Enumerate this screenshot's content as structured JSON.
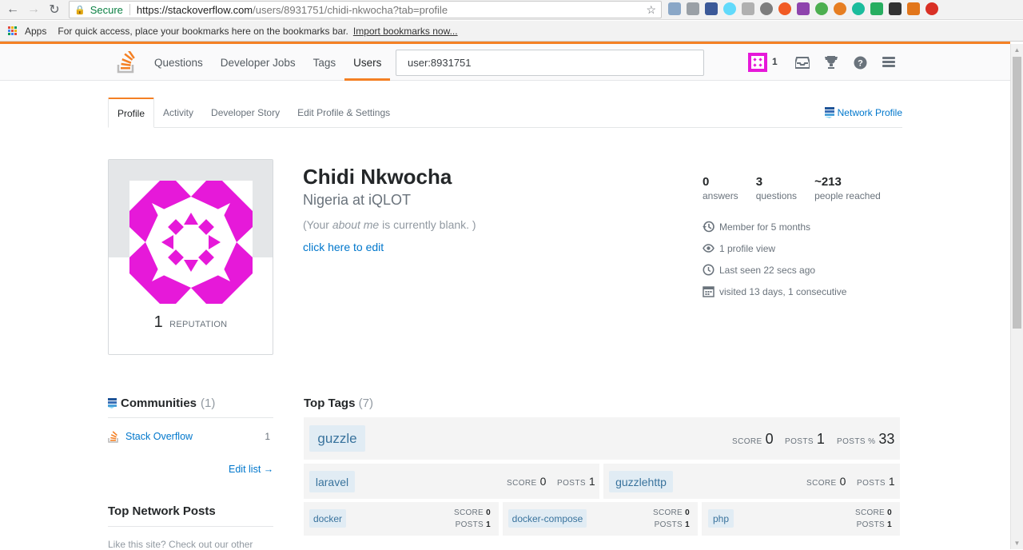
{
  "browser": {
    "secure_label": "Secure",
    "url_host": "https://stackoverflow.com",
    "url_rest": "/users/8931751/chidi-nkwocha?tab=profile",
    "bookmarks_apps": "Apps",
    "bookmarks_hint": "For quick access, place your bookmarks here on the bookmarks bar.",
    "bookmarks_import": "Import bookmarks now..."
  },
  "topbar": {
    "nav": [
      "Questions",
      "Developer Jobs",
      "Tags",
      "Users"
    ],
    "active": "Users",
    "search_value": "user:8931751",
    "rep": "1"
  },
  "tabs": {
    "items": [
      "Profile",
      "Activity",
      "Developer Story",
      "Edit Profile & Settings"
    ],
    "network_profile": "Network Profile"
  },
  "profile": {
    "reputation": "1",
    "reputation_label": "REPUTATION",
    "name": "Chidi Nkwocha",
    "location": "Nigeria at iQLOT",
    "about_prefix": "(Your ",
    "about_em": "about me",
    "about_suffix": " is currently blank. )",
    "edit_link": "click here to edit"
  },
  "stats": {
    "answers": {
      "num": "0",
      "label": "answers"
    },
    "questions": {
      "num": "3",
      "label": "questions"
    },
    "reached": {
      "num": "~213",
      "label": "people reached"
    }
  },
  "meta": {
    "member": "Member for 5 months",
    "views": "1 profile view",
    "last_seen": "Last seen 22 secs ago",
    "visited": "visited 13 days, 1 consecutive"
  },
  "communities": {
    "title": "Communities",
    "count": "(1)",
    "item_name": "Stack Overflow",
    "item_rep": "1",
    "edit_list": "Edit list →"
  },
  "top_network_posts": {
    "title": "Top Network Posts",
    "text": "Like this site? Check out our other"
  },
  "top_tags": {
    "title": "Top Tags",
    "count": "(7)",
    "labels": {
      "score": "SCORE",
      "posts": "POSTS",
      "posts_pct": "POSTS %"
    },
    "tags": [
      {
        "name": "guzzle",
        "score": "0",
        "posts": "1",
        "posts_pct": "33"
      },
      {
        "name": "laravel",
        "score": "0",
        "posts": "1"
      },
      {
        "name": "guzzlehttp",
        "score": "0",
        "posts": "1"
      },
      {
        "name": "docker",
        "score": "0",
        "posts": "1"
      },
      {
        "name": "docker-compose",
        "score": "0",
        "posts": "1"
      },
      {
        "name": "php",
        "score": "0",
        "posts": "1"
      }
    ]
  },
  "colors": {
    "accent": "#f48024",
    "link": "#0077cc",
    "avatar": "#e619d9"
  }
}
